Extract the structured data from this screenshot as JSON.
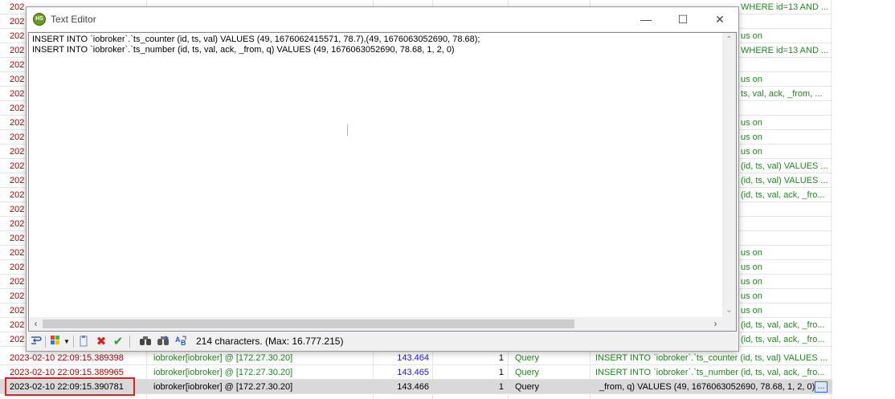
{
  "background_partial_rows": [
    {
      "ts": "202",
      "info": "WHERE id=13 AND ..."
    },
    {
      "ts": "202",
      "info": ""
    },
    {
      "ts": "202",
      "info": "us on"
    },
    {
      "ts": "202",
      "info": "WHERE id=13 AND ..."
    },
    {
      "ts": "202",
      "info": ""
    },
    {
      "ts": "202",
      "info": "us on"
    },
    {
      "ts": "202",
      "info": "ts, val, ack, _from, ..."
    },
    {
      "ts": "202",
      "info": ""
    },
    {
      "ts": "202",
      "info": "us on"
    },
    {
      "ts": "202",
      "info": "us on"
    },
    {
      "ts": "202",
      "info": "us on"
    },
    {
      "ts": "202",
      "info": "(id, ts, val) VALUES ..."
    },
    {
      "ts": "202",
      "info": "(id, ts, val) VALUES ..."
    },
    {
      "ts": "202",
      "info": "(id, ts, val, ack, _fro..."
    },
    {
      "ts": "202",
      "info": ""
    },
    {
      "ts": "202",
      "info": ""
    },
    {
      "ts": "202",
      "info": ""
    },
    {
      "ts": "202",
      "info": "us on"
    },
    {
      "ts": "202",
      "info": "us on"
    },
    {
      "ts": "202",
      "info": "us on"
    },
    {
      "ts": "202",
      "info": "us on"
    },
    {
      "ts": "202",
      "info": "us on"
    },
    {
      "ts": "202",
      "info": "(id, ts, val, ack, _fro..."
    },
    {
      "ts": "202",
      "info": "(id, ts, val, ack, _fro..."
    }
  ],
  "log_rows": [
    {
      "ts": "2023-02-10 22:09:15.389398",
      "user": "iobroker[iobroker] @  [172.27.30.20]",
      "duration": "143.464",
      "n": "1",
      "command": "Query",
      "info": "INSERT INTO `iobroker`.`ts_counter (id, ts, val) VALUES ..."
    },
    {
      "ts": "2023-02-10 22:09:15.389965",
      "user": "iobroker[iobroker] @  [172.27.30.20]",
      "duration": "143.465",
      "n": "1",
      "command": "Query",
      "info": "INSERT INTO `iobroker`.`ts_number (id, ts, val, ack, _fro..."
    },
    {
      "ts": "2023-02-10 22:09:15.390781",
      "user": "iobroker[iobroker] @  [172.27.30.20]",
      "duration": "143.466",
      "n": "1",
      "command": "Query",
      "info": "_from, q) VALUES (49, 1676063052690, 78.68, 1, 2, 0)"
    }
  ],
  "selected_row_edit_button": "...",
  "editor": {
    "title": "Text Editor",
    "app_icon_text": "HS",
    "window_buttons": {
      "minimize": "—",
      "maximize": "☐",
      "close": "✕"
    },
    "content_lines": [
      "INSERT INTO `iobroker`.`ts_counter (id, ts, val) VALUES (49, 1676062415571, 78.7),(49, 1676063052690, 78.68);",
      "INSERT INTO `iobroker`.`ts_number (id, ts, val, ack, _from, q) VALUES (49, 1676063052690, 78.68, 1, 2, 0)"
    ],
    "char_count_text": "214 characters. (Max: 16.777.215)",
    "toolbar_icons": [
      "wrap-icon",
      "windows-flag-icon",
      "dropdown-arrow-icon",
      "clipboard-icon",
      "cancel-icon",
      "apply-icon",
      "binoculars-find-icon",
      "binoculars-find-next-icon",
      "replace-icon"
    ],
    "colors": {
      "apply": "#2e9d2e",
      "cancel": "#d62020",
      "titlebar": "#ffffff"
    }
  }
}
